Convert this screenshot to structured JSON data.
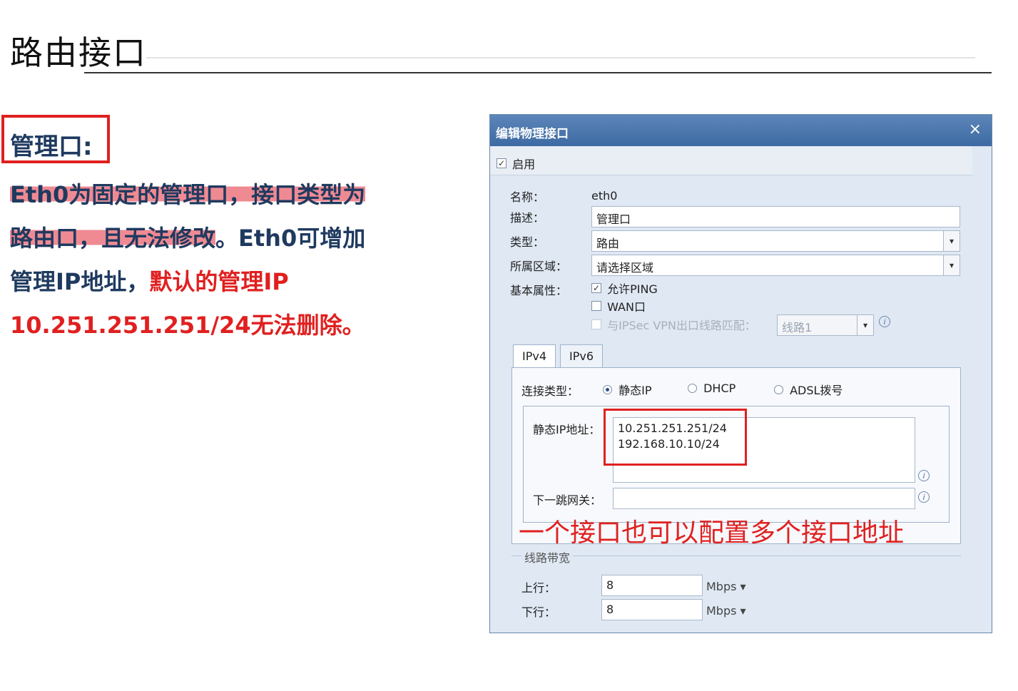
{
  "slide": {
    "title": "路由接口",
    "mgmt_label": "管理口:",
    "desc_line1": "Eth0为固定的管理口，接口类型为",
    "desc_line2_a": "路由口，且无法修改",
    "desc_line2_b": "。Eth0可增加",
    "desc_line3_a": "管理IP地址，",
    "desc_line3_b": "默认的管理IP",
    "desc_line4": "10.251.251.251/24无法删除。"
  },
  "dialog": {
    "title": "编辑物理接口",
    "close": "×",
    "enable_label": "启用",
    "enable_checked": "✓",
    "name_label": "名称：",
    "name_value": "eth0",
    "desc_label": "描述：",
    "desc_value": "管理口",
    "type_label": "类型：",
    "type_value": "路由",
    "zone_label": "所属区域：",
    "zone_value": "请选择区域",
    "attr_label": "基本属性：",
    "allow_ping_label": "允许PING",
    "allow_ping_checked": "✓",
    "wan_label": "WAN口",
    "ipsec_label": "与IPSec VPN出口线路匹配：",
    "line_value": "线路1",
    "tabs": [
      "IPv4",
      "IPv6"
    ],
    "conn_type_label": "连接类型：",
    "radio_static": "静态IP",
    "radio_dhcp": "DHCP",
    "radio_adsl": "ADSL拨号",
    "static_ip_label": "静态IP地址：",
    "static_ips": [
      "10.251.251.251/24",
      "192.168.10.10/24"
    ],
    "gateway_label": "下一跳网关：",
    "bandwidth_legend": "线路带宽",
    "up_label": "上行：",
    "up_value": "8",
    "up_unit": "Mbps ▾",
    "down_label": "下行：",
    "down_value": "8",
    "down_unit": "Mbps ▾",
    "info_glyph": "i",
    "arrow_glyph": "▾"
  },
  "annotation": "一个接口也可以配置多个接口地址"
}
